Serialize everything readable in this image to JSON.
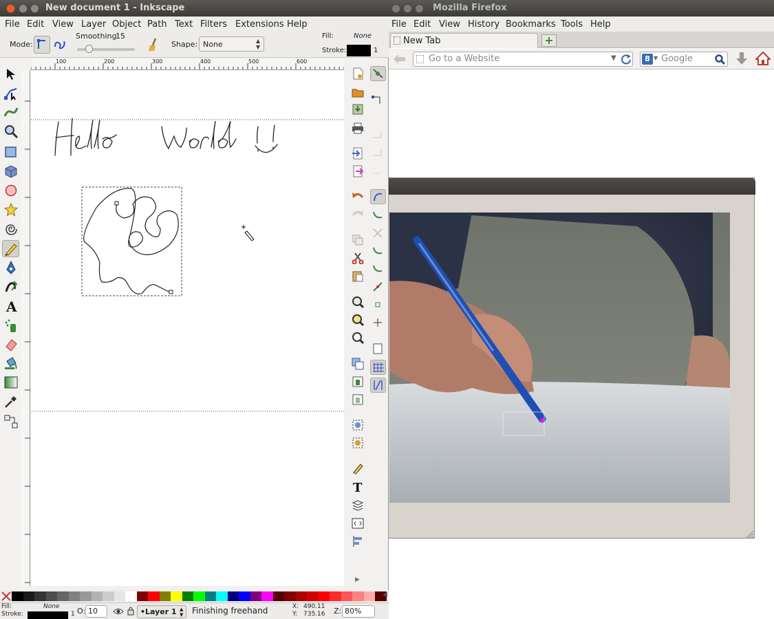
{
  "firefox": {
    "title": "Mozilla Firefox",
    "menu": [
      "File",
      "Edit",
      "View",
      "History",
      "Bookmarks",
      "Tools",
      "Help"
    ],
    "tab_label": "New Tab",
    "newtab_symbol": "+",
    "url_placeholder": "Go to a Website",
    "search_placeholder": "Google"
  },
  "inkscape": {
    "title": "New document 1 - Inkscape",
    "menu": [
      "File",
      "Edit",
      "View",
      "Layer",
      "Object",
      "Path",
      "Text",
      "Filters",
      "Extensions",
      "Help"
    ],
    "controls": {
      "mode_label": "Mode:",
      "smoothing_label": "Smoothing:",
      "smoothing_value": "15",
      "smoothing_fraction": 0.15,
      "shape_label": "Shape:",
      "shape_value": "None",
      "fill_label": "Fill:",
      "fill_value": "None",
      "stroke_label": "Stroke:",
      "stroke_width": "1"
    },
    "ruler_top_labels": [
      "100",
      "200",
      "300",
      "400",
      "500",
      "600"
    ],
    "canvas_text": "Hello World !!",
    "status": {
      "fill_label": "Fill:",
      "fill_value": "None",
      "stroke_label": "Stroke:",
      "stroke_width": "1",
      "opacity_label": "O:",
      "opacity_value": "10",
      "layer_value": "•Layer 1",
      "message": "Finishing freehand",
      "x_label": "X:",
      "x_value": "490.11",
      "y_label": "Y:",
      "y_value": "735.16",
      "zoom_label": "Z:",
      "zoom_value": "80%"
    },
    "palette_colors": [
      "#000000",
      "#1a1a1a",
      "#333333",
      "#4d4d4d",
      "#666666",
      "#808080",
      "#999999",
      "#b3b3b3",
      "#cccccc",
      "#e6e6e6",
      "#ffffff",
      "#800000",
      "#ff0000",
      "#808000",
      "#ffff00",
      "#008000",
      "#00ff00",
      "#008080",
      "#00ffff",
      "#000080",
      "#0000ff",
      "#800080",
      "#ff00ff",
      "#550000",
      "#800000",
      "#aa0000",
      "#d40000",
      "#ff0000",
      "#ff2a2a",
      "#ff5555",
      "#ff8080",
      "#ffaaaa",
      "#550000"
    ]
  }
}
